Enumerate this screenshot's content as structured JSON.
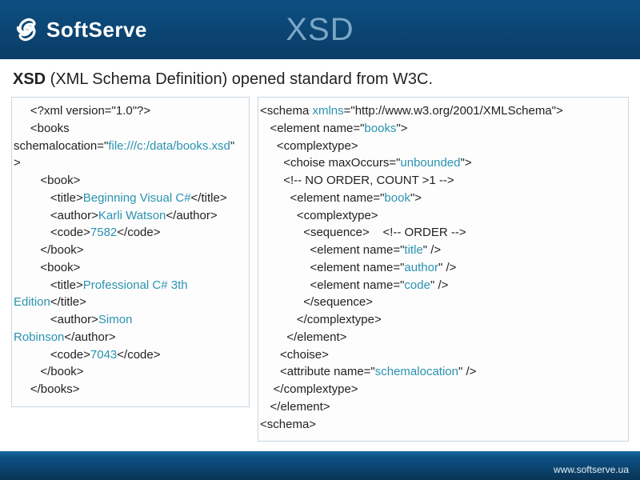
{
  "header": {
    "brand": "SoftServe",
    "title": "XSD"
  },
  "subtitle": {
    "bold": "XSD",
    "rest": " (XML Schema Definition) opened standard from W3C."
  },
  "xml": {
    "declaration": "<?xml version=\"1.0\"?>",
    "booksOpen": "<books",
    "attrName": "schemalocation=\"",
    "attrValue": "file:///c:/data/books.xsd",
    "attrClose": "\"",
    "rootClose": ">",
    "bookOpen": "<book>",
    "titleOpen": "<title>",
    "title1": "Beginning Visual C#",
    "titleClose": "</title>",
    "authorOpen": "<author>",
    "author1": "Karli Watson",
    "authorClose": "</author>",
    "codeOpen": "<code>",
    "code1": "7582",
    "codeClose": "</code>",
    "bookClose": "</book>",
    "title2a": "Professional C# 3th",
    "title2b": "Edition",
    "author2a": "Simon",
    "author2b": "Robinson",
    "code2": "7043",
    "booksClose": "</books>"
  },
  "xsd": {
    "schemaOpen1": "<schema ",
    "xmlns": "xmlns",
    "schemaOpen2": "=\"http://www.w3.org/2001/XMLSchema\">",
    "elemNameOpen": "<element name=\"",
    "books": "books",
    "elemNameClose": "\">",
    "complexOpen": "<complextype>",
    "choiseOpen1": "<choise maxOccurs=\"",
    "unbounded": "unbounded",
    "choiseOpen2": "\">",
    "comment1": "<!-- NO ORDER, COUNT >1 -->",
    "book": "book",
    "sequenceOpen": "<sequence>",
    "comment2": "<!-- ORDER -->",
    "title": "title",
    "author": "author",
    "code": "code",
    "selfClose": "\" />",
    "sequenceClose": "</sequence>",
    "complexClose": "</complextype>",
    "elemClose": "</element>",
    "choiseClose": "<choise>",
    "attrOpen": "<attribute name=\"",
    "schemalocation": "schemalocation",
    "schemaClose": "<schema>"
  },
  "footer": {
    "url": "www.softserve.ua"
  }
}
